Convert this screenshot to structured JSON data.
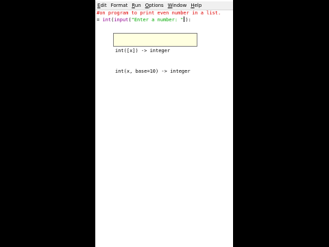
{
  "menubar": {
    "items": [
      {
        "mnemonic": "E",
        "rest": "dit"
      },
      {
        "mnemonic": "",
        "rest": "Format"
      },
      {
        "mnemonic": "R",
        "rest": "un"
      },
      {
        "mnemonic": "O",
        "rest": "ptions"
      },
      {
        "mnemonic": "W",
        "rest": "indow"
      },
      {
        "mnemonic": "H",
        "rest": "elp"
      }
    ]
  },
  "editor": {
    "line1": "#on program to print even number in a list.",
    "line2": {
      "prefix": "= ",
      "builtin1": "int",
      "paren1": "(",
      "builtin2": "input",
      "paren2": "(",
      "string": "\"Enter a number: \"",
      "after": "):"
    }
  },
  "calltip": {
    "lines": [
      "int([x]) -> integer",
      "int(x, base=10) -> integer"
    ]
  },
  "colors": {
    "comment": "#dd0000",
    "builtin": "#900090",
    "string": "#00aa00",
    "calltip_bg": "#ffffe0"
  }
}
